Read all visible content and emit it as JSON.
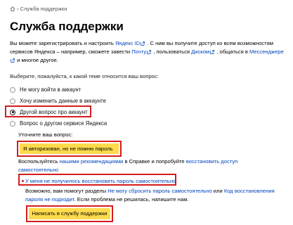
{
  "breadcrumb": {
    "current": "Служба поддержки"
  },
  "title": "Служба поддержки",
  "intro": {
    "part1": "Вы можете зарегистрировать и настроить ",
    "link_id": "Яндекс ID",
    "part2": " . С ним вы получите доступ ко всем возможностям сервисов Яндекса – например, сможете завести ",
    "link_mail": "Почту",
    "part3": " , пользоваться ",
    "link_disk": "Диском",
    "part4": " , общаться в ",
    "link_messenger": "Мессенджере",
    "part5": " и многое другое."
  },
  "question": "Выберите, пожалуйста, к какой теме относится ваш вопрос:",
  "options": [
    {
      "label": "Не могу войти в аккаунт",
      "checked": false
    },
    {
      "label": "Хочу изменить данные в аккаунте",
      "checked": false
    },
    {
      "label": "Другой вопрос про аккаунт",
      "checked": true
    },
    {
      "label": "Вопрос о другом сервисе Яндекса",
      "checked": false
    }
  ],
  "clarify_label": "Уточните ваш вопрос:",
  "clarify_value": "Я авторизован, но не помню пароль",
  "advice": {
    "part1": "Воспользуйтесь ",
    "link1": "нашими рекомендациями",
    "part2": " в Справке и попробуйте ",
    "link2": "восстановить доступ самостоятельно"
  },
  "second_select": "У меня не получилось восстановить пароль самостоятельно",
  "help": {
    "part1": "Возможно, вам помогут разделы ",
    "link1": "Не могу сбросить пароль самостоятельно",
    "part2": " или ",
    "link2": "Код восстановления пароля не подходит",
    "part3": ". Если проблема не решилась, напишите нам."
  },
  "submit_label": "Написать в службу поддержки",
  "colors": {
    "accent_yellow": "#ffdb4d",
    "link": "#0044bb",
    "highlight_red": "#d61c1c"
  }
}
